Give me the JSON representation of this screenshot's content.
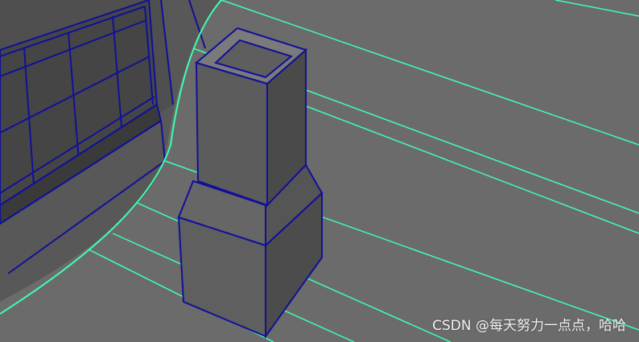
{
  "watermark": {
    "text": "CSDN @每天努力一点点，哈哈"
  },
  "colors": {
    "roof": "#6c6c6c",
    "roof_dark": "#5d5d5d",
    "wall": "#595959",
    "wall_dark": "#3c3c3c",
    "glass": "#555555",
    "chimney_front": "#5e5e5e",
    "chimney_side": "#4d4d4d",
    "chimney_top": "#7a7a7a",
    "wire_green": "#3dffb0",
    "wire_blue": "#10109a"
  },
  "icons": [
    "none"
  ]
}
